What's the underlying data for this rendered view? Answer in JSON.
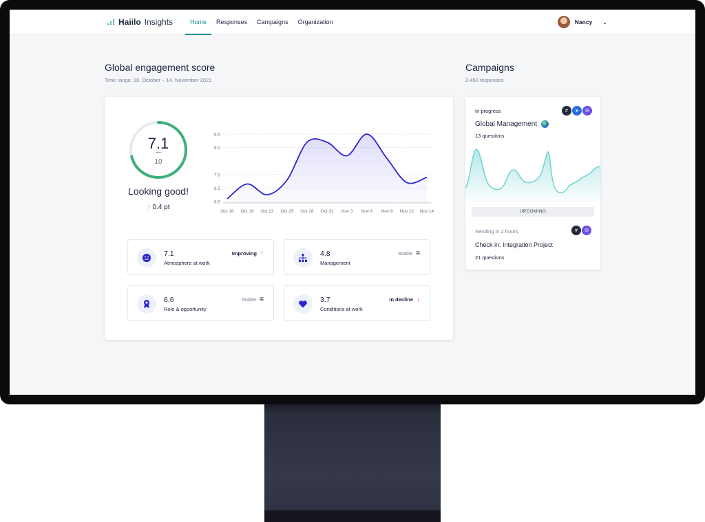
{
  "app": {
    "brand_bold": "Haiilo",
    "brand_light": "Insights"
  },
  "nav": {
    "items": [
      "Home",
      "Responses",
      "Campaigns",
      "Organization"
    ],
    "active": "Home"
  },
  "user": {
    "name": "Nancy"
  },
  "engagement": {
    "title": "Global engagement score",
    "time_range": "Time range: 16. October  –  14. November 2021",
    "score": "7.1",
    "max": "10",
    "score_fraction": 0.71,
    "status": "Looking good!",
    "delta": "0.4 pt"
  },
  "chart_data": {
    "type": "line",
    "x": [
      "Oct 16",
      "Oct 19",
      "Oct 22",
      "Oct 25",
      "Oct 28",
      "Oct 31",
      "Nov 3",
      "Nov 6",
      "Nov 9",
      "Nov 12",
      "Nov 14"
    ],
    "y": [
      6.1,
      6.65,
      6.25,
      6.8,
      8.2,
      8.2,
      7.7,
      8.5,
      7.6,
      6.7,
      6.9
    ],
    "ylim": [
      6.0,
      8.5
    ],
    "yticks": [
      "8.5",
      "8.0",
      "7.0",
      "6.5",
      "6.0"
    ],
    "grid": true,
    "color": "#2a23d1"
  },
  "metrics": [
    {
      "value": "7.1",
      "label": "Atmosphere at work",
      "trend": "Improving",
      "trend_kind": "up",
      "icon": "smiley-icon"
    },
    {
      "value": "4.8",
      "label": "Management",
      "trend": "Stable",
      "trend_kind": "stable",
      "icon": "hierarchy-icon"
    },
    {
      "value": "6.6",
      "label": "Role & opportunity",
      "trend": "Stable",
      "trend_kind": "stable",
      "icon": "award-icon"
    },
    {
      "value": "3.7",
      "label": "Conditions at work",
      "trend": "In decline",
      "trend_kind": "down",
      "icon": "heart-icon"
    }
  ],
  "campaigns": {
    "title": "Campaigns",
    "responses": "2.450 responses",
    "in_progress": {
      "status": "In progress",
      "name": "Global Management",
      "questions": "13 questions"
    },
    "upcoming_label": "UPCOMING",
    "upcoming": {
      "status": "Sending in 2 hours",
      "name": "Check in: Integration Project",
      "questions": "21 questions"
    }
  },
  "colors": {
    "accent": "#1a8c95",
    "line": "#2a23d1",
    "gauge": "#3bb07a",
    "up": "#2ea56a",
    "down": "#e0523a",
    "sparkline": "#76d5d3"
  }
}
